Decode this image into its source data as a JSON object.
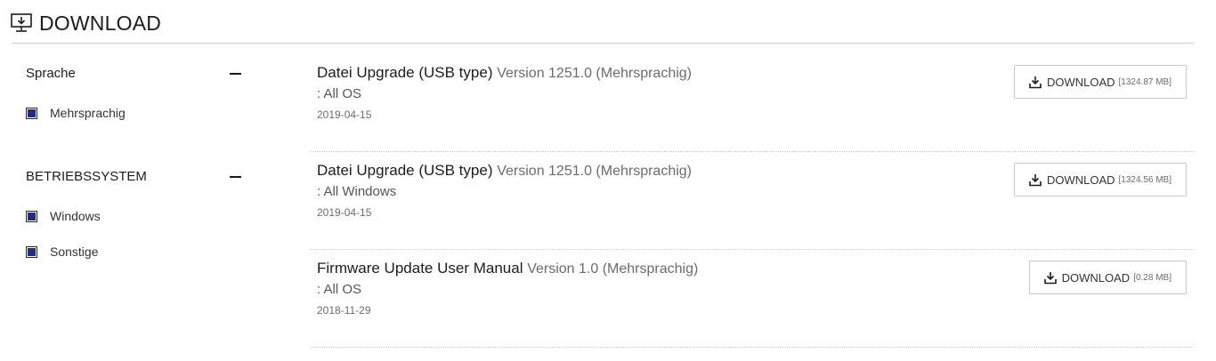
{
  "header": {
    "title": "DOWNLOAD",
    "icon": "monitor-download-icon"
  },
  "filters": [
    {
      "title": "Sprache",
      "options": [
        "Mehrsprachig"
      ]
    },
    {
      "title": "BETRIEBSSYSTEM",
      "options": [
        "Windows",
        "Sonstige"
      ]
    }
  ],
  "downloads": [
    {
      "name": "Datei Upgrade (USB type)",
      "version": "Version 1251.0 (Mehrsprachig)",
      "os": ": All OS",
      "date": "2019-04-15",
      "button": "DOWNLOAD",
      "size": "[1324.87 MB]"
    },
    {
      "name": "Datei Upgrade (USB type)",
      "version": "Version 1251.0 (Mehrsprachig)",
      "os": ": All Windows",
      "date": "2019-04-15",
      "button": "DOWNLOAD",
      "size": "[1324.56 MB]"
    },
    {
      "name": "Firmware Update User Manual",
      "version": "Version 1.0 (Mehrsprachig)",
      "os": ": All OS",
      "date": "2018-11-29",
      "button": "DOWNLOAD",
      "size": "[0.28 MB]"
    }
  ],
  "colors": {
    "checkbox": "#1f2b91",
    "divider": "#cfcfcf",
    "text": "#1c1c1c"
  }
}
